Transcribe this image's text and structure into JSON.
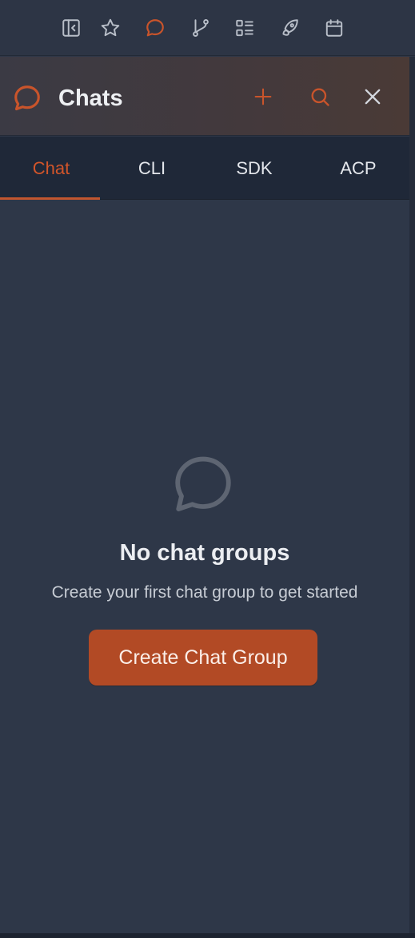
{
  "colors": {
    "accent": "#c2562f",
    "button_bg": "#b24a25",
    "icon_muted": "#b8bec8",
    "background": "#2e3748"
  },
  "toolbar": {
    "icons": [
      "sidebar-toggle-icon",
      "star-icon",
      "chat-icon",
      "git-branch-icon",
      "list-icon",
      "rocket-icon",
      "calendar-icon"
    ]
  },
  "header": {
    "title": "Chats",
    "icons": [
      "chat-icon",
      "plus-icon",
      "search-icon",
      "close-icon"
    ]
  },
  "tabs": [
    {
      "label": "Chat",
      "active": true
    },
    {
      "label": "CLI",
      "active": false
    },
    {
      "label": "SDK",
      "active": false
    },
    {
      "label": "ACP",
      "active": false
    }
  ],
  "empty_state": {
    "icon": "chat-bubble-icon",
    "title": "No chat groups",
    "subtitle": "Create your first chat group to get started",
    "button_label": "Create Chat Group"
  }
}
